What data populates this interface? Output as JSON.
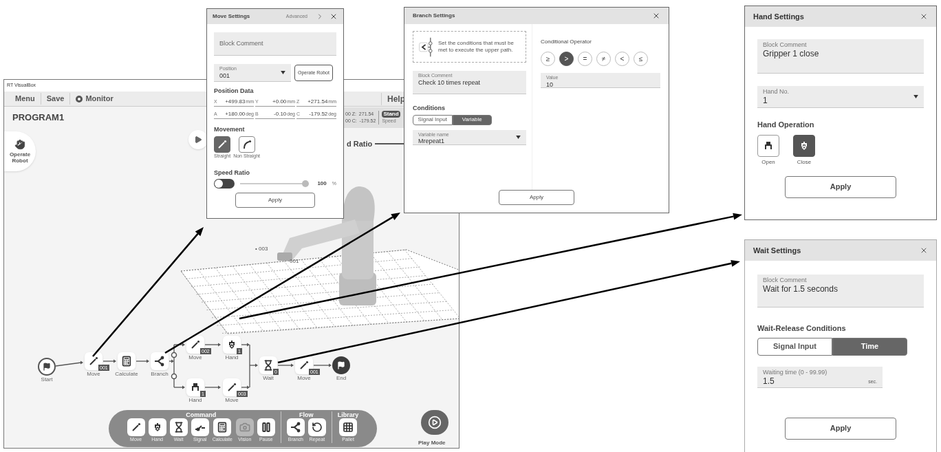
{
  "main_window": {
    "title": "RT VisualBox",
    "menu": [
      {
        "label": "Menu",
        "icon": false
      },
      {
        "label": "Save",
        "icon": false
      },
      {
        "label": "Monitor",
        "icon": true
      }
    ],
    "help": "Help",
    "program_name": "PROGRAM1",
    "operate_robot": "Operate Robot",
    "readouts": [
      "00 Z:  271.54",
      "00 C:  -179.52"
    ],
    "mode_badge": "Stand",
    "speed_label": "Speed",
    "ratio_label": "d Ratio",
    "markers": [
      "• 003",
      "001"
    ],
    "flow": [
      {
        "kind": "start",
        "label": "Start"
      },
      {
        "kind": "move",
        "label": "Move",
        "badge": "001"
      },
      {
        "kind": "calculate",
        "label": "Calculate"
      },
      {
        "kind": "branch",
        "label": "Branch"
      },
      {
        "kind": "move",
        "label": "Move",
        "badge": "002"
      },
      {
        "kind": "hand",
        "label": "Hand",
        "badge": "1"
      },
      {
        "kind": "hand_open",
        "label": "Hand",
        "badge": "1"
      },
      {
        "kind": "move",
        "label": "Move",
        "badge": "003"
      },
      {
        "kind": "wait",
        "label": "Wait",
        "badge": "0"
      },
      {
        "kind": "move",
        "label": "Move",
        "badge": "001"
      },
      {
        "kind": "end",
        "label": "End"
      }
    ],
    "palette": [
      {
        "title": "Command",
        "items": [
          {
            "kind": "move",
            "label": "Move",
            "disabled": false
          },
          {
            "kind": "hand",
            "label": "Hand",
            "disabled": false
          },
          {
            "kind": "wait",
            "label": "Wait",
            "disabled": false
          },
          {
            "kind": "signal",
            "label": "Signal",
            "disabled": false
          },
          {
            "kind": "calculate",
            "label": "Calculate",
            "disabled": false
          },
          {
            "kind": "vision",
            "label": "Vision",
            "disabled": true
          },
          {
            "kind": "pause",
            "label": "Pause",
            "disabled": false
          }
        ]
      },
      {
        "title": "Flow",
        "items": [
          {
            "kind": "branch",
            "label": "Branch",
            "disabled": false
          },
          {
            "kind": "repeat",
            "label": "Repeat",
            "disabled": false
          }
        ]
      },
      {
        "title": "Library",
        "items": [
          {
            "kind": "pallet",
            "label": "Pallet",
            "disabled": false
          }
        ]
      }
    ],
    "play_mode": "Play Mode"
  },
  "move_settings": {
    "title": "Move Settings",
    "advanced": "Advanced",
    "block_comment": {
      "placeholder": "Block Comment"
    },
    "position": {
      "label": "Position",
      "value": "001"
    },
    "operate_robot": "Operate Robot",
    "position_data_title": "Position Data",
    "position_data": [
      {
        "axis": "X",
        "value": "+499.83",
        "unit": "mm"
      },
      {
        "axis": "Y",
        "value": "+0.00",
        "unit": "mm"
      },
      {
        "axis": "Z",
        "value": "+271.54",
        "unit": "mm"
      },
      {
        "axis": "A",
        "value": "+180.00",
        "unit": "deg"
      },
      {
        "axis": "B",
        "value": "-0.10",
        "unit": "deg"
      },
      {
        "axis": "C",
        "value": "-179.52",
        "unit": "deg"
      }
    ],
    "movement_title": "Movement",
    "movement": [
      {
        "kind": "straight",
        "label": "Straight",
        "selected": true
      },
      {
        "kind": "curve",
        "label": "Non Straight",
        "selected": false
      }
    ],
    "speed_title": "Speed Ratio",
    "speed_toggle_on": false,
    "speed": {
      "level": 1.0,
      "reading": "100",
      "unit": "%"
    },
    "apply": "Apply"
  },
  "branch_settings": {
    "title": "Branch Settings",
    "hint": "Set the conditions that must be met to execute the upper path.",
    "block_comment": {
      "label": "Block Comment",
      "value": "Check 10 times repeat"
    },
    "conditions_title": "Conditions",
    "condition_tabs": [
      {
        "label": "Signal Input",
        "selected": false
      },
      {
        "label": "Variable",
        "selected": true
      }
    ],
    "variable": {
      "label": "Variable name",
      "value": "Mrepeat1"
    },
    "operator_title": "Conditional Operator",
    "operators": [
      {
        "label": "≥",
        "selected": false
      },
      {
        "label": ">",
        "selected": true
      },
      {
        "label": "=",
        "selected": false
      },
      {
        "label": "≠",
        "selected": false
      },
      {
        "label": "<",
        "selected": false
      },
      {
        "label": "≤",
        "selected": false
      }
    ],
    "value": {
      "label": "Value",
      "value": "10"
    },
    "apply": "Apply"
  },
  "hand_settings": {
    "title": "Hand Settings",
    "block_comment": {
      "label": "Block Comment",
      "value": "Gripper 1 close"
    },
    "hand_no": {
      "label": "Hand No.",
      "value": "1"
    },
    "operation_title": "Hand Operation",
    "operations": [
      {
        "kind": "open",
        "label": "Open",
        "selected": false
      },
      {
        "kind": "close",
        "label": "Close",
        "selected": true
      }
    ],
    "apply": "Apply"
  },
  "wait_settings": {
    "title": "Wait Settings",
    "block_comment": {
      "label": "Block Comment",
      "value": "Wait for 1.5 seconds"
    },
    "conditions_title": "Wait-Release Conditions",
    "condition_tabs": [
      {
        "label": "Signal Input",
        "selected": false
      },
      {
        "label": "Time",
        "selected": true
      }
    ],
    "waiting_time": {
      "label": "Waiting time (0 - 99.99)",
      "value": "1.5",
      "unit": "sec."
    },
    "apply": "Apply"
  }
}
